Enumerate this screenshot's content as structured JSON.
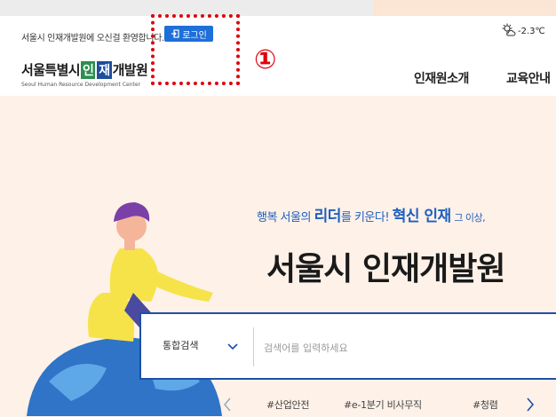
{
  "topbar": {
    "welcome_text": "서울시 인재개발원에 오신걸 환영합니다.",
    "login_label": "로그인",
    "annotation_number": "①",
    "weather_temp": "-2.3℃"
  },
  "logo": {
    "part1": "서울특별시",
    "part2": "인",
    "part3": "재",
    "part4": "개발원",
    "subtitle": "Seoul Human Resource Development Center"
  },
  "nav": {
    "items": [
      {
        "label": "인재원소개"
      },
      {
        "label": "교육안내"
      }
    ]
  },
  "hero": {
    "headline_1": "행복 서울의",
    "headline_2": "리더",
    "headline_3": "를 키운다!",
    "headline_4": "혁신 인재",
    "headline_5": "그 이상,",
    "title": "서울시 인재개발원"
  },
  "search": {
    "category": "통합검색",
    "placeholder": "검색어를 입력하세요"
  },
  "tags": [
    "#산업안전",
    "#e-1분기 비사무직",
    "#청렴"
  ],
  "colors": {
    "accent_blue": "#1e6fd8",
    "annotation_red": "#e0000a",
    "hero_bg": "#fdf1e8"
  },
  "icons": {
    "login": "login-icon",
    "weather": "sun-cloud-icon",
    "dropdown": "chevron-down-icon",
    "prev": "chevron-left-icon",
    "next": "chevron-right-icon"
  }
}
